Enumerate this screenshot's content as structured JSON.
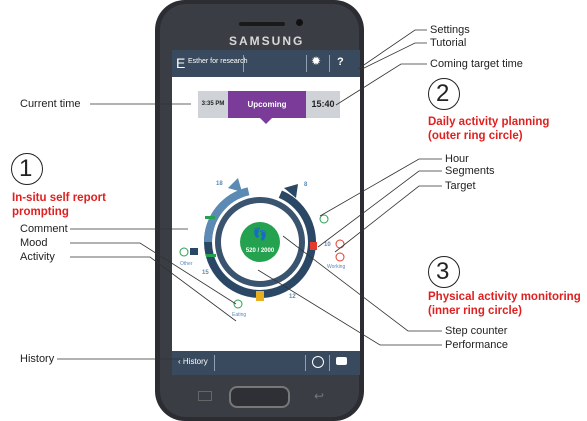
{
  "phone": {
    "brand": "SAMSUNG",
    "app_title": "Esther for research",
    "help_glyph": "?",
    "history_label": "History",
    "upcoming": {
      "time_left": "3:35 PM",
      "label": "Upcoming",
      "time_right": "15:40"
    },
    "ring": {
      "steps": "520 / 2000",
      "hours": [
        "18",
        "8",
        "10",
        "15",
        "12"
      ],
      "activities": [
        "Other",
        "Working",
        "Eating"
      ]
    },
    "colors": {
      "ring_dark": "#2b4766",
      "ring_blue": "#5b8ab5",
      "accent": "#7a3c98",
      "green": "#25a24f",
      "red": "#e53b2c",
      "yellow": "#e8b020"
    }
  },
  "labels": {
    "settings": "Settings",
    "tutorial": "Tutorial",
    "coming_target_time": "Coming target time",
    "current_time": "Current time",
    "hour": "Hour",
    "segments": "Segments",
    "target": "Target",
    "comment": "Comment",
    "mood": "Mood",
    "activity": "Activity",
    "step_counter": "Step counter",
    "performance": "Performance",
    "history": "History"
  },
  "sections": [
    {
      "number": "1",
      "title": "In-situ self report prompting"
    },
    {
      "number": "2",
      "title": "Daily activity planning (outer ring circle)"
    },
    {
      "number": "3",
      "title": "Physical activity monitoring (inner ring circle)"
    }
  ]
}
